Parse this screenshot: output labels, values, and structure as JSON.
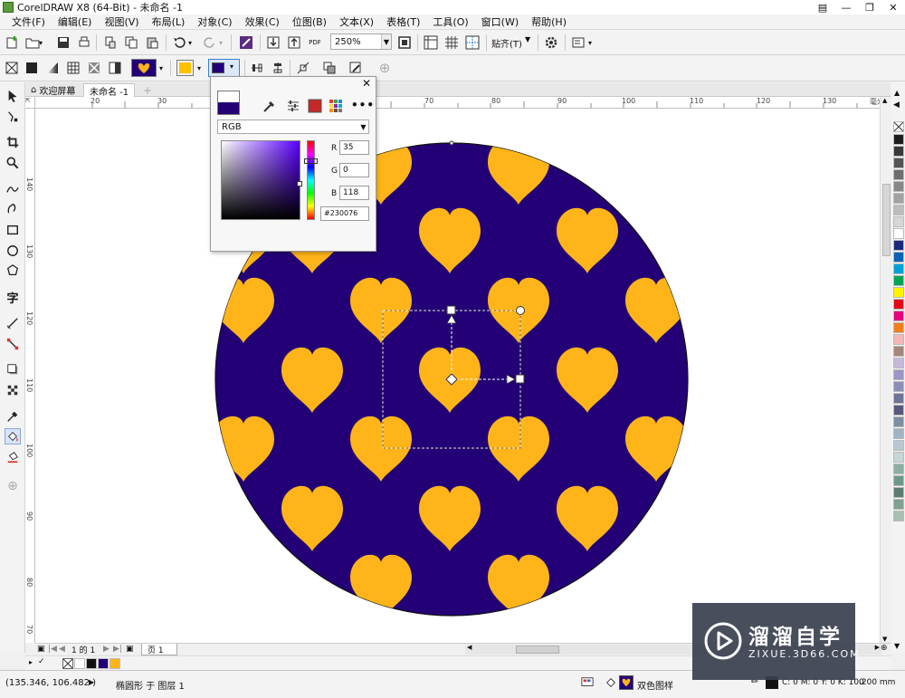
{
  "window": {
    "title": "CorelDRAW X8 (64-Bit) - 未命名 -1"
  },
  "menu": [
    "文件(F)",
    "编辑(E)",
    "视图(V)",
    "布局(L)",
    "对象(C)",
    "效果(C)",
    "位图(B)",
    "文本(X)",
    "表格(T)",
    "工具(O)",
    "窗口(W)",
    "帮助(H)"
  ],
  "toolbar1": {
    "zoom": "250%",
    "snap_label": "贴齐(T)",
    "pdf_label": "PDF"
  },
  "tabs": {
    "welcome": "欢迎屏幕",
    "document": "未命名 -1"
  },
  "ruler": {
    "h_labels": [
      "20",
      "30",
      "70",
      "80",
      "90",
      "100",
      "110",
      "120",
      "130"
    ],
    "h_unit": "毫米",
    "v_labels": [
      "140",
      "130",
      "120",
      "110",
      "100",
      "90",
      "80",
      "70"
    ]
  },
  "color_popup": {
    "model": "RGB",
    "r_label": "R",
    "r": "35",
    "g_label": "G",
    "g": "0",
    "b_label": "B",
    "b": "118",
    "hex": "#230076"
  },
  "colors": {
    "background": "#230076",
    "foreground": "#ffb519",
    "fill_swatch": "#ffc000"
  },
  "page_nav": {
    "page_of": "1 的 1",
    "page_tab": "页 1"
  },
  "status": {
    "coords": "(135.346, 106.482 )",
    "object_info": "椭圆形 于 图层 1",
    "fill_type": "双色图样",
    "outline_info": "C: 0 M: 0 Y: 0 K: 100",
    "outline_width": ".200 mm"
  },
  "watermark": {
    "title": "溜溜自学",
    "url": "ZIXUE.3D66.COM"
  },
  "palette": [
    "#1e1e1e",
    "#3a3a3a",
    "#555555",
    "#6e6e6e",
    "#888888",
    "#a2a2a2",
    "#bcbcbc",
    "#d6d6d6",
    "#ffffff",
    "#1c2a7e",
    "#0b63b8",
    "#00a0d8",
    "#00a650",
    "#fff200",
    "#e30613",
    "#e6007e",
    "#ef7f1a",
    "#f4b6b6",
    "#a4867a",
    "#c7b8d8",
    "#9c96c8",
    "#8b8fb8",
    "#6e7398",
    "#55597b",
    "#7e8ea0",
    "#9fb3c3",
    "#b7c8d2",
    "#c5d6d8",
    "#8ab0a6",
    "#6c9a8a",
    "#5a7f70",
    "#80a090",
    "#a8c0b0"
  ]
}
